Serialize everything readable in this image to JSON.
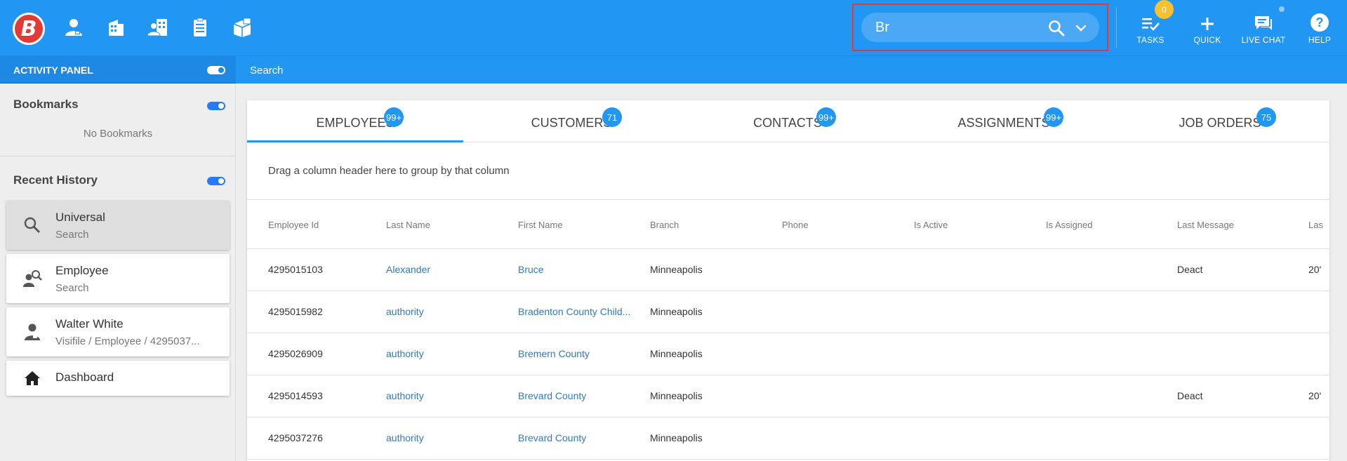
{
  "brand": {
    "logo_letter": "B"
  },
  "search": {
    "value": "Br"
  },
  "top_actions": {
    "tasks_label": "TASKS",
    "tasks_count": "0",
    "quick_label": "QUICK",
    "live_chat_label": "LIVE CHAT",
    "help_label": "HELP"
  },
  "activity_panel": {
    "title": "ACTIVITY PANEL"
  },
  "breadcrumb": "Search",
  "sidebar": {
    "bookmarks_title": "Bookmarks",
    "no_bookmarks": "No Bookmarks",
    "recent_title": "Recent History",
    "history": [
      {
        "title": "Universal",
        "subtitle": "Search"
      },
      {
        "title": "Employee",
        "subtitle": "Search"
      },
      {
        "title": "Walter White",
        "subtitle": "Visifile / Employee / 4295037..."
      },
      {
        "title": "Dashboard",
        "subtitle": ""
      }
    ]
  },
  "tabs": [
    {
      "label": "EMPLOYEES",
      "count": "99+"
    },
    {
      "label": "CUSTOMERS",
      "count": "71"
    },
    {
      "label": "CONTACTS",
      "count": "99+"
    },
    {
      "label": "ASSIGNMENTS",
      "count": "99+"
    },
    {
      "label": "JOB ORDERS",
      "count": "75"
    }
  ],
  "grouping_hint": "Drag a column header here to group by that column",
  "columns": [
    "Employee Id",
    "Last Name",
    "First Name",
    "Branch",
    "Phone",
    "Is Active",
    "Is Assigned",
    "Last Message",
    "Las"
  ],
  "rows": [
    {
      "id": "4295015103",
      "last": "Alexander",
      "first": "Bruce",
      "branch": "Minneapolis",
      "phone": "",
      "active": "",
      "assigned": "",
      "message": "Deact",
      "extra": "20'"
    },
    {
      "id": "4295015982",
      "last": "authority",
      "first": "Bradenton County Child...",
      "branch": "Minneapolis",
      "phone": "",
      "active": "",
      "assigned": "",
      "message": "",
      "extra": ""
    },
    {
      "id": "4295026909",
      "last": "authority",
      "first": "Bremern County",
      "branch": "Minneapolis",
      "phone": "",
      "active": "",
      "assigned": "",
      "message": "",
      "extra": ""
    },
    {
      "id": "4295014593",
      "last": "authority",
      "first": "Brevard County",
      "branch": "Minneapolis",
      "phone": "",
      "active": "",
      "assigned": "",
      "message": "Deact",
      "extra": "20'"
    },
    {
      "id": "4295037276",
      "last": "authority",
      "first": "Brevard County",
      "branch": "Minneapolis",
      "phone": "",
      "active": "",
      "assigned": "",
      "message": "",
      "extra": ""
    }
  ],
  "colors": {
    "primary": "#2196f3",
    "badge_yellow": "#fbc02d",
    "logo_red": "#e53935",
    "link": "#337ab7",
    "highlight_border": "#e53935"
  }
}
